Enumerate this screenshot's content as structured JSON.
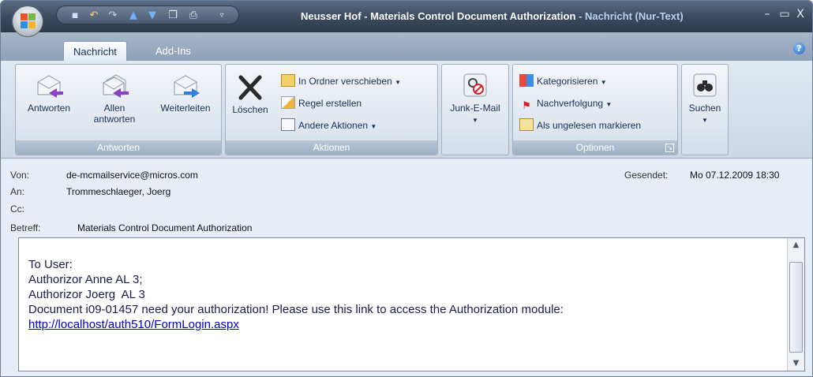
{
  "window": {
    "title_subject": "Neusser Hof - Materials Control Document Authorization",
    "title_separator": " - ",
    "title_mode": "Nachricht (Nur-Text)",
    "minimize_label": "–",
    "maximize_label": "▭",
    "close_label": "X"
  },
  "tabs": [
    {
      "label": "Nachricht",
      "active": true
    },
    {
      "label": "Add-Ins",
      "active": false
    }
  ],
  "help_label": "?",
  "ribbon": {
    "antworten_group": {
      "label": "Antworten",
      "reply": "Antworten",
      "reply_all_line1": "Allen",
      "reply_all_line2": "antworten",
      "forward": "Weiterleiten"
    },
    "aktionen_group": {
      "label": "Aktionen",
      "delete": "Löschen",
      "move_to_folder": "In Ordner verschieben",
      "create_rule": "Regel erstellen",
      "other_actions": "Andere Aktionen"
    },
    "junk_group": {
      "junk_email": "Junk-E-Mail"
    },
    "optionen_group": {
      "label": "Optionen",
      "categorize": "Kategorisieren",
      "follow_up": "Nachverfolgung",
      "mark_unread": "Als ungelesen markieren"
    },
    "suchen_group": {
      "find": "Suchen"
    }
  },
  "header": {
    "from_label": "Von:",
    "from_value": "de-mcmailservice@micros.com",
    "to_label": "An:",
    "to_value": "Trommeschlaeger, Joerg",
    "cc_label": "Cc:",
    "cc_value": "",
    "subject_label": "Betreff:",
    "subject_value": "Materials Control Document Authorization",
    "sent_label": "Gesendet:",
    "sent_value": "Mo 07.12.2009 18:30"
  },
  "body": {
    "line1": "To User:",
    "line2": "Authorizor Anne AL 3;",
    "line3": "Authorizor Joerg  AL 3",
    "line4": "Document i09-01457 need your authorization! Please use this link to access the Authorization module:",
    "link": "http://localhost/auth510/FormLogin.aspx"
  },
  "colors": {
    "title_text": "#ffffff",
    "title_mode_text": "#b9d3f2",
    "ribbon_text": "#15305a",
    "link": "#0000d0"
  }
}
